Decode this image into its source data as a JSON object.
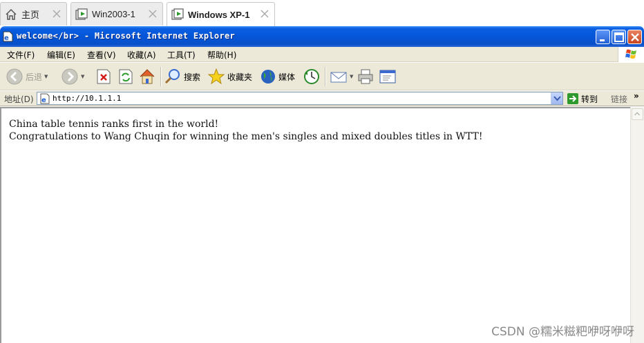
{
  "vm_tabs": [
    {
      "label": "主页",
      "icon": "home-icon",
      "active": false
    },
    {
      "label": "Win2003-1",
      "icon": "vm-icon",
      "active": false
    },
    {
      "label": "Windows XP-1",
      "icon": "vm-icon",
      "active": true
    }
  ],
  "ie": {
    "title": "welcome</br> - Microsoft Internet Explorer",
    "menu": [
      "文件(F)",
      "编辑(E)",
      "查看(V)",
      "收藏(A)",
      "工具(T)",
      "帮助(H)"
    ],
    "toolbar": {
      "back": "后退",
      "search": "搜索",
      "favorites": "收藏夹",
      "media": "媒体"
    },
    "address": {
      "label": "地址(D)",
      "value": "http://10.1.1.1",
      "go": "转到",
      "links": "链接",
      "links_chevron": "»"
    },
    "page_content": {
      "line1": "China table tennis ranks first in the world!",
      "line2": "Congratulations to Wang Chuqin for winning the men's singles and mixed doubles titles in WTT!"
    }
  },
  "watermark": "CSDN @糯米糍粑咿呀咿呀",
  "colors": {
    "titlebar": "#0456d8",
    "chrome": "#ece9d8",
    "close_button": "#c9461f"
  }
}
